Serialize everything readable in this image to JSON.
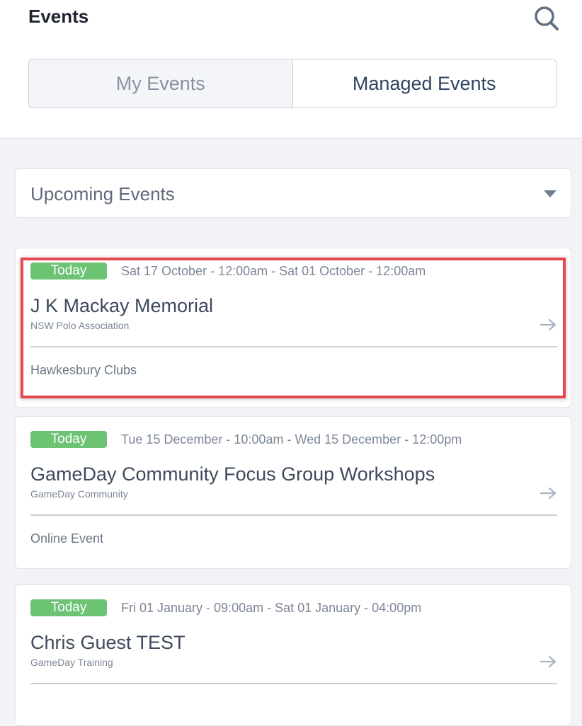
{
  "header": {
    "title": "Events",
    "tabs": [
      {
        "label": "My Events"
      },
      {
        "label": "Managed Events"
      }
    ]
  },
  "filter": {
    "selected": "Upcoming Events"
  },
  "events": [
    {
      "badge": "Today",
      "dates": "Sat 17 October - 12:00am - Sat 01 October - 12:00am",
      "title": "J K Mackay Memorial",
      "organisation": "NSW Polo Association",
      "location": "Hawkesbury Clubs"
    },
    {
      "badge": "Today",
      "dates": "Tue 15 December - 10:00am - Wed 15 December - 12:00pm",
      "title": "GameDay Community Focus Group Workshops",
      "organisation": "GameDay Community",
      "location": "Online Event"
    },
    {
      "badge": "Today",
      "dates": "Fri 01 January - 09:00am - Sat 01 January - 04:00pm",
      "title": "Chris Guest TEST",
      "organisation": "GameDay Training",
      "location": ""
    }
  ],
  "colors": {
    "badge": "#6cc374",
    "highlight": "#e5484d",
    "active_tab_text": "#2f4460"
  },
  "icons": {
    "search": "search-icon",
    "arrow": "arrow-right-icon",
    "dropdown": "chevron-down-icon"
  }
}
